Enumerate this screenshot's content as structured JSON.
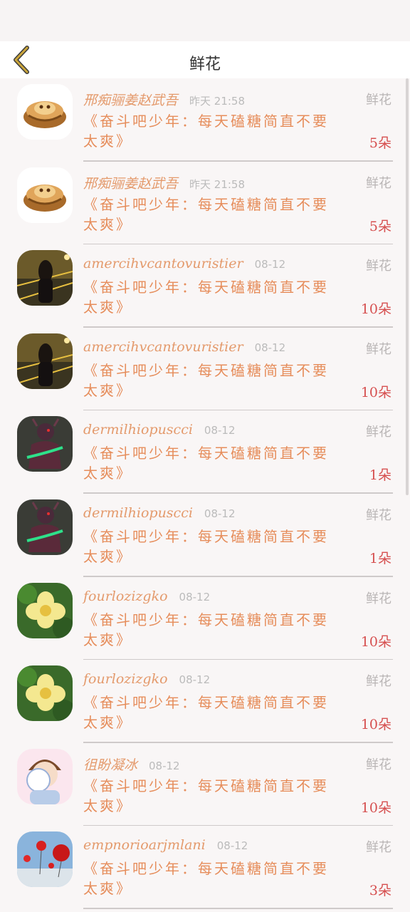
{
  "status_bar": {
    "left_text": "",
    "right_text": ""
  },
  "header": {
    "title": "鲜花",
    "back_icon": "chevron-left-icon"
  },
  "colors": {
    "name": "#e49a6c",
    "message": "#e68d5b",
    "count": "#d65050",
    "back": "#b89a2e"
  },
  "items": [
    {
      "avatar": "treasure-chest",
      "name": "邢痴骊姜赵武吾",
      "time": "昨天 21:58",
      "type": "鲜花",
      "message": "《奋斗吧少年：每天磕糖简直不要太爽》",
      "count": "5朵"
    },
    {
      "avatar": "treasure-chest",
      "name": "邢痴骊姜赵武吾",
      "time": "昨天 21:58",
      "type": "鲜花",
      "message": "《奋斗吧少年：每天磕糖简直不要太爽》",
      "count": "5朵"
    },
    {
      "avatar": "night-girl",
      "name": "amercihvcantovuristier",
      "time": "08-12",
      "type": "鲜花",
      "message": "《奋斗吧少年：每天磕糖简直不要太爽》",
      "count": "10朵"
    },
    {
      "avatar": "night-girl",
      "name": "amercihvcantovuristier",
      "time": "08-12",
      "type": "鲜花",
      "message": "《奋斗吧少年：每天磕糖简直不要太爽》",
      "count": "10朵"
    },
    {
      "avatar": "armored-warrior",
      "name": "dermilhiopuscci",
      "time": "08-12",
      "type": "鲜花",
      "message": "《奋斗吧少年：每天磕糖简直不要太爽》",
      "count": "1朵"
    },
    {
      "avatar": "armored-warrior",
      "name": "dermilhiopuscci",
      "time": "08-12",
      "type": "鲜花",
      "message": "《奋斗吧少年：每天磕糖简直不要太爽》",
      "count": "1朵"
    },
    {
      "avatar": "yellow-flower",
      "name": "fourlozizgko",
      "time": "08-12",
      "type": "鲜花",
      "message": "《奋斗吧少年：每天磕糖简直不要太爽》",
      "count": "10朵"
    },
    {
      "avatar": "yellow-flower",
      "name": "fourlozizgko",
      "time": "08-12",
      "type": "鲜花",
      "message": "《奋斗吧少年：每天磕糖简直不要太爽》",
      "count": "10朵"
    },
    {
      "avatar": "cartoon-boy",
      "name": "徂盼凝冰",
      "time": "08-12",
      "type": "鲜花",
      "message": "《奋斗吧少年：每天磕糖简直不要太爽》",
      "count": "10朵"
    },
    {
      "avatar": "red-balloons",
      "name": "empnorioarjmlani",
      "time": "08-12",
      "type": "鲜花",
      "message": "《奋斗吧少年：每天磕糖简直不要太爽》",
      "count": "3朵"
    }
  ]
}
